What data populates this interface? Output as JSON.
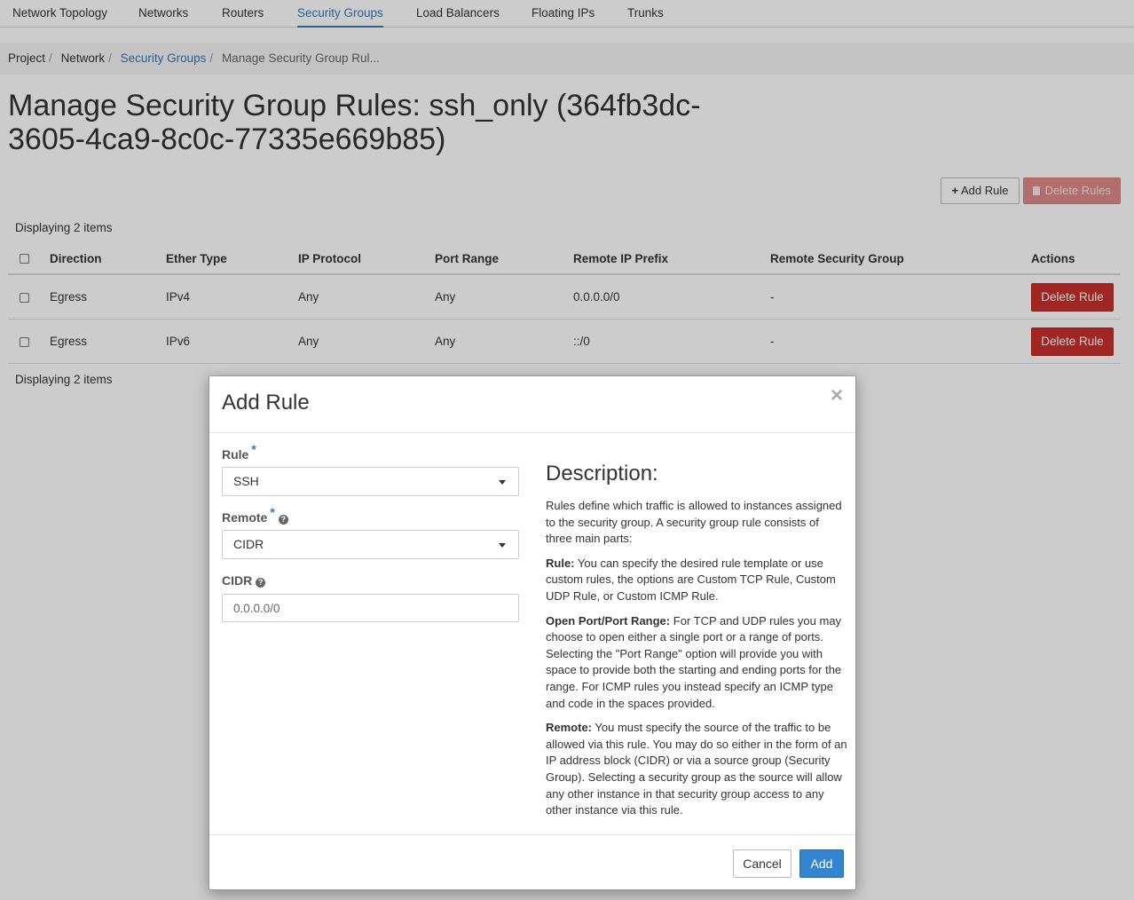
{
  "nav": {
    "tabs": [
      {
        "label": "Network Topology"
      },
      {
        "label": "Networks"
      },
      {
        "label": "Routers"
      },
      {
        "label": "Security Groups",
        "active": true
      },
      {
        "label": "Load Balancers"
      },
      {
        "label": "Floating IPs"
      },
      {
        "label": "Trunks"
      }
    ]
  },
  "breadcrumb": {
    "items": [
      "Project",
      "Network",
      "Security Groups",
      "Manage Security Group Rul..."
    ]
  },
  "page": {
    "title": "Manage Security Group Rules: ssh_only (364fb3dc-3605-4ca9-8c0c-77335e669b85)"
  },
  "toolbar": {
    "add_rule_label": "Add Rule",
    "delete_rules_label": "Delete Rules"
  },
  "table": {
    "count_label": "Displaying 2 items",
    "headers": [
      "Direction",
      "Ether Type",
      "IP Protocol",
      "Port Range",
      "Remote IP Prefix",
      "Remote Security Group",
      "Actions"
    ],
    "rows": [
      {
        "direction": "Egress",
        "ether_type": "IPv4",
        "ip_protocol": "Any",
        "port_range": "Any",
        "remote_ip_prefix": "0.0.0.0/0",
        "remote_security_group": "-",
        "action": "Delete Rule"
      },
      {
        "direction": "Egress",
        "ether_type": "IPv6",
        "ip_protocol": "Any",
        "port_range": "Any",
        "remote_ip_prefix": "::/0",
        "remote_security_group": "-",
        "action": "Delete Rule"
      }
    ]
  },
  "modal": {
    "title": "Add Rule",
    "close_symbol": "×",
    "rule": {
      "label": "Rule",
      "value": "SSH"
    },
    "remote": {
      "label": "Remote",
      "value": "CIDR"
    },
    "cidr": {
      "label": "CIDR",
      "placeholder": "0.0.0.0/0"
    },
    "required_mark": "*",
    "description": {
      "heading": "Description:",
      "intro": "Rules define which traffic is allowed to instances assigned to the security group. A security group rule consists of three main parts:",
      "rule_term": "Rule:",
      "rule_text": "You can specify the desired rule template or use custom rules, the options are Custom TCP Rule, Custom UDP Rule, or Custom ICMP Rule.",
      "port_term": "Open Port/Port Range:",
      "port_text": "For TCP and UDP rules you may choose to open either a single port or a range of ports. Selecting the \"Port Range\" option will provide you with space to provide both the starting and ending ports for the range. For ICMP rules you instead specify an ICMP type and code in the spaces provided.",
      "remote_term": "Remote:",
      "remote_text": "You must specify the source of the traffic to be allowed via this rule. You may do so either in the form of an IP address block (CIDR) or via a source group (Security Group). Selecting a security group as the source will allow any other instance in that security group access to any other instance via this rule."
    },
    "cancel_label": "Cancel",
    "add_label": "Add"
  },
  "colors": {
    "accent": "#337ab7",
    "danger": "#c9302c",
    "primary": "#3385d1"
  }
}
